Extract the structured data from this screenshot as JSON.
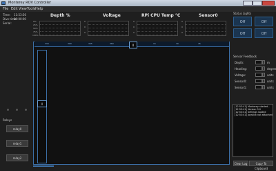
{
  "window": {
    "title": "Monterey ROV Controller"
  },
  "menu": [
    "File",
    "Edit",
    "View",
    "Tools",
    "Help"
  ],
  "status": {
    "time_label": "Time:",
    "time_value": "11:53:56",
    "dive_label": "Dive time:",
    "dive_value": "00:00:00",
    "serial_label": "Serial:"
  },
  "charts": [
    {
      "title": "Depth %",
      "ticks": [
        "0%",
        "25%",
        "50%",
        "75%",
        "100%"
      ]
    },
    {
      "title": "Voltage",
      "ticks": [
        "0",
        "0",
        "0",
        "0",
        "0"
      ]
    },
    {
      "title": "RPi CPU Temp °C",
      "ticks": [
        "0",
        "0",
        "0",
        "0",
        "0"
      ]
    },
    {
      "title": "Sensor0",
      "ticks": [
        "0",
        "0",
        "0",
        "0",
        "0"
      ]
    }
  ],
  "status_lights": {
    "title": "Status Lights",
    "lights": [
      "Off",
      "Off",
      "Off",
      "Off"
    ]
  },
  "compass": {
    "heading_value": "0",
    "ticks": [
      "330",
      "300",
      "345",
      "360",
      "0",
      "15",
      "30",
      "45"
    ]
  },
  "depth_gauge": {
    "value": "0"
  },
  "sensor_feedback": {
    "title": "Sensor Feedback",
    "rows": [
      {
        "label": "Depth:",
        "unit": "m"
      },
      {
        "label": "Heading:",
        "unit": "degrees"
      },
      {
        "label": "Voltage:",
        "unit": "volts"
      },
      {
        "label": "Sensor0:",
        "unit": "units"
      },
      {
        "label": "Sensor1:",
        "unit": "units"
      }
    ]
  },
  "log": [
    "[12:53:41] Monterey started...",
    "[12:53:41] Version 3.0",
    "[12:53:41] Settings loaded",
    "[12:53:41] Joystick not attached"
  ],
  "log_buttons": {
    "clear": "Clear Log",
    "copy": "Copy To Clipboard"
  },
  "relays": {
    "title": "Relays",
    "buttons": [
      "relay0",
      "relay1",
      "relay2"
    ]
  }
}
